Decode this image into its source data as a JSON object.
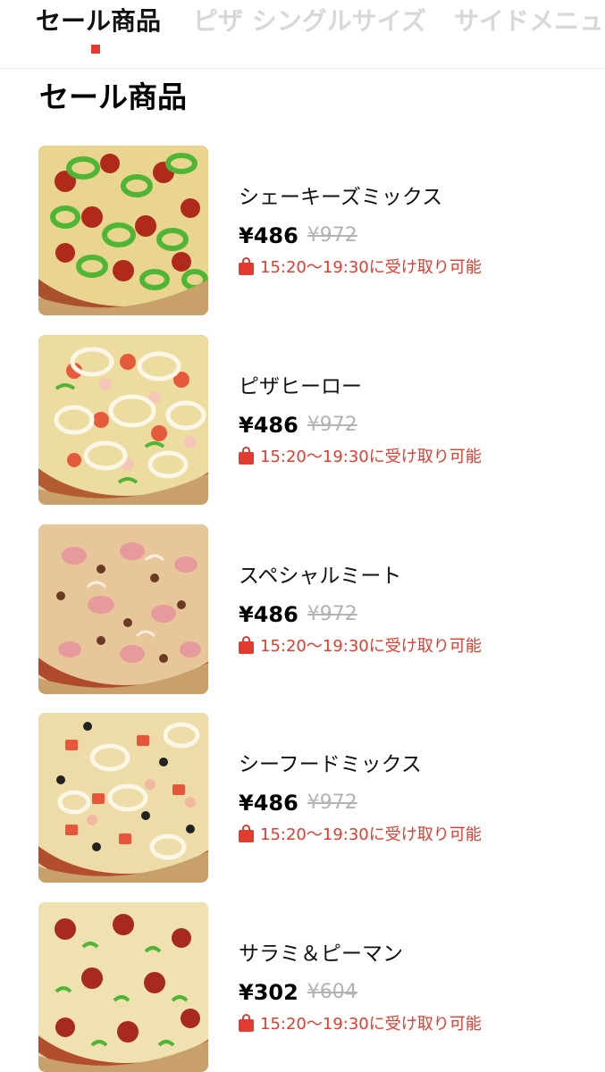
{
  "tabs": [
    {
      "label": "セール商品",
      "active": true
    },
    {
      "label": "ピザ シングルサイズ",
      "active": false
    },
    {
      "label": "サイドメニュー",
      "active": false
    }
  ],
  "section_title": "セール商品",
  "colors": {
    "accent": "#e8372c",
    "pickup_text": "#e23b2f",
    "old_price": "#b3b3b3",
    "inactive_tab": "#d8d8d8"
  },
  "items": [
    {
      "name": "シェーキーズミックス",
      "price": "¥486",
      "old_price": "¥972",
      "pickup": "15:20〜19:30に受け取り可能",
      "icon": "shopping-bag-icon",
      "image": "pizza-image"
    },
    {
      "name": "ピザヒーロー",
      "price": "¥486",
      "old_price": "¥972",
      "pickup": "15:20〜19:30に受け取り可能",
      "icon": "shopping-bag-icon",
      "image": "pizza-image"
    },
    {
      "name": "スペシャルミート",
      "price": "¥486",
      "old_price": "¥972",
      "pickup": "15:20〜19:30に受け取り可能",
      "icon": "shopping-bag-icon",
      "image": "pizza-image"
    },
    {
      "name": "シーフードミックス",
      "price": "¥486",
      "old_price": "¥972",
      "pickup": "15:20〜19:30に受け取り可能",
      "icon": "shopping-bag-icon",
      "image": "pizza-image"
    },
    {
      "name": "サラミ＆ピーマン",
      "price": "¥302",
      "old_price": "¥604",
      "pickup": "15:20〜19:30に受け取り可能",
      "icon": "shopping-bag-icon",
      "image": "pizza-image"
    }
  ]
}
